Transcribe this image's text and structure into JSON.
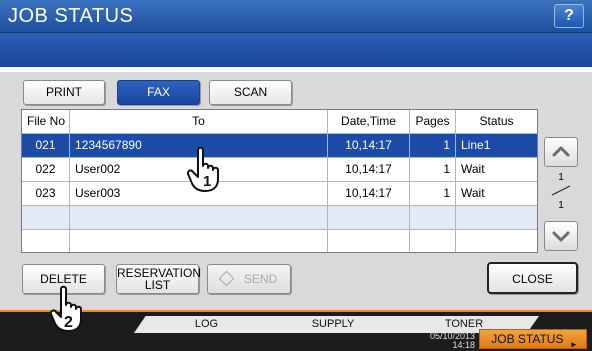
{
  "window": {
    "title": "JOB STATUS",
    "help_label": "?"
  },
  "tabs": [
    {
      "label": "PRINT",
      "active": false
    },
    {
      "label": "FAX",
      "active": true
    },
    {
      "label": "SCAN",
      "active": false
    }
  ],
  "table": {
    "headers": [
      "File No",
      "To",
      "Date,Time",
      "Pages",
      "Status"
    ],
    "rows": [
      {
        "file_no": "021",
        "to": "1234567890",
        "date_time": "10,14:17",
        "pages": "1",
        "status": "Line1",
        "selected": true
      },
      {
        "file_no": "022",
        "to": "User002",
        "date_time": "10,14:17",
        "pages": "1",
        "status": "Wait",
        "selected": false
      },
      {
        "file_no": "023",
        "to": "User003",
        "date_time": "10,14:17",
        "pages": "1",
        "status": "Wait",
        "selected": false
      }
    ]
  },
  "pagination": {
    "current": "1",
    "total": "1"
  },
  "actions": {
    "delete_label": "DELETE",
    "reservation_line1": "RESERVATION",
    "reservation_line2": "LIST",
    "send_label": "SEND",
    "close_label": "CLOSE"
  },
  "bottom_tabs": [
    "LOG",
    "SUPPLY",
    "TONER"
  ],
  "footer": {
    "date": "05/10/2013",
    "time": "14:18",
    "job_status_label": "JOB STATUS"
  },
  "callouts": [
    "1",
    "2"
  ],
  "colors": {
    "title_blue": "#2a5fb5",
    "selected_row": "#1c4ca8",
    "accent_orange": "#f0891b"
  }
}
